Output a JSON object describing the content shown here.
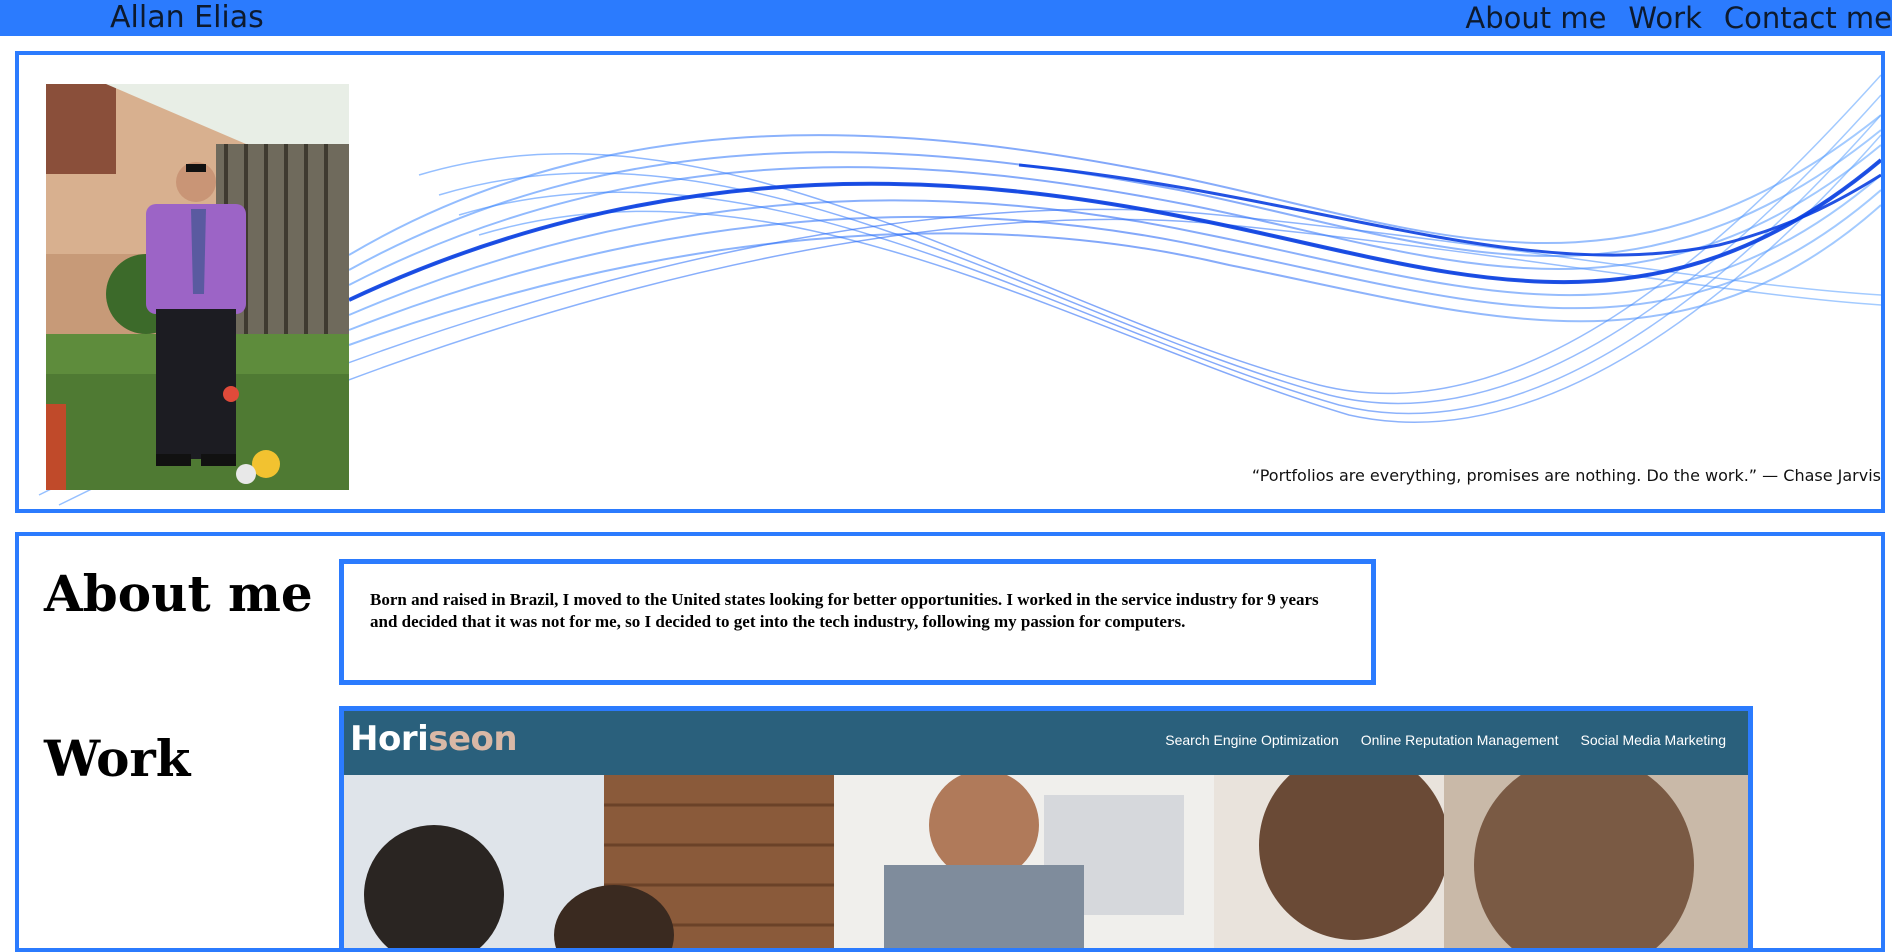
{
  "header": {
    "name": "Allan Elias",
    "nav": [
      "About me",
      "Work",
      "Contact me"
    ]
  },
  "hero": {
    "quote": "“Portfolios are everything, promises are nothing. Do the work.” — Chase Jarvis"
  },
  "about": {
    "heading": "About me",
    "text": "Born and raised in Brazil, I moved to the United states looking for better opportunities. I worked in the service industry for 9 years and decided that it was not for me, so I decided to get into the tech industry, following my passion for computers."
  },
  "work": {
    "heading": "Work",
    "project": {
      "logo_main": "Hori",
      "logo_accent": "seon",
      "links": [
        "Search Engine Optimization",
        "Online Reputation Management",
        "Social Media Marketing"
      ]
    }
  },
  "colors": {
    "accent": "#2b7bfe",
    "project_header": "#2a607c"
  }
}
